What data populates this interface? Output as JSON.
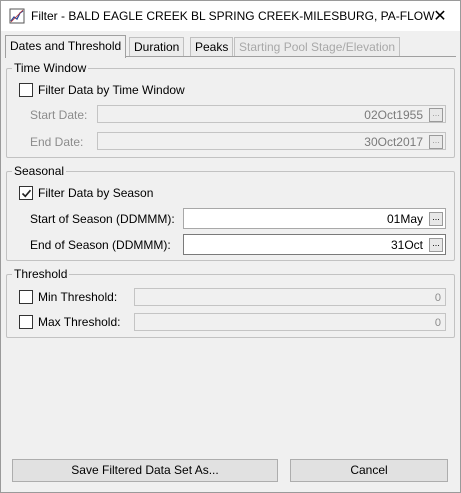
{
  "window": {
    "title": "Filter - BALD EAGLE CREEK BL SPRING CREEK-MILESBURG, PA-FLOW",
    "close_symbol": "✕",
    "app_icon": "filter-app-icon"
  },
  "tabs": [
    {
      "label": "Dates and Threshold",
      "state": "active"
    },
    {
      "label": "Duration",
      "state": "enabled"
    },
    {
      "label": "Peaks",
      "state": "enabled"
    },
    {
      "label": "Starting Pool Stage/Elevation",
      "state": "disabled"
    }
  ],
  "time_window": {
    "legend": "Time Window",
    "filter_label": "Filter Data by Time Window",
    "filter_checked": false,
    "start_label": "Start Date:",
    "start_value": "02Oct1955",
    "end_label": "End Date:",
    "end_value": "30Oct2017",
    "picker_symbol": "..."
  },
  "seasonal": {
    "legend": "Seasonal",
    "filter_label": "Filter Data by Season",
    "filter_checked": true,
    "start_label": "Start of Season (DDMMM):",
    "start_value": "01May",
    "end_label": "End of Season (DDMMM):",
    "end_value": "31Oct",
    "picker_symbol": "..."
  },
  "threshold": {
    "legend": "Threshold",
    "min_label": "Min Threshold:",
    "min_checked": false,
    "min_value": "0",
    "max_label": "Max Threshold:",
    "max_checked": false,
    "max_value": "0"
  },
  "buttons": {
    "save_label": "Save Filtered Data Set As...",
    "cancel_label": "Cancel"
  }
}
